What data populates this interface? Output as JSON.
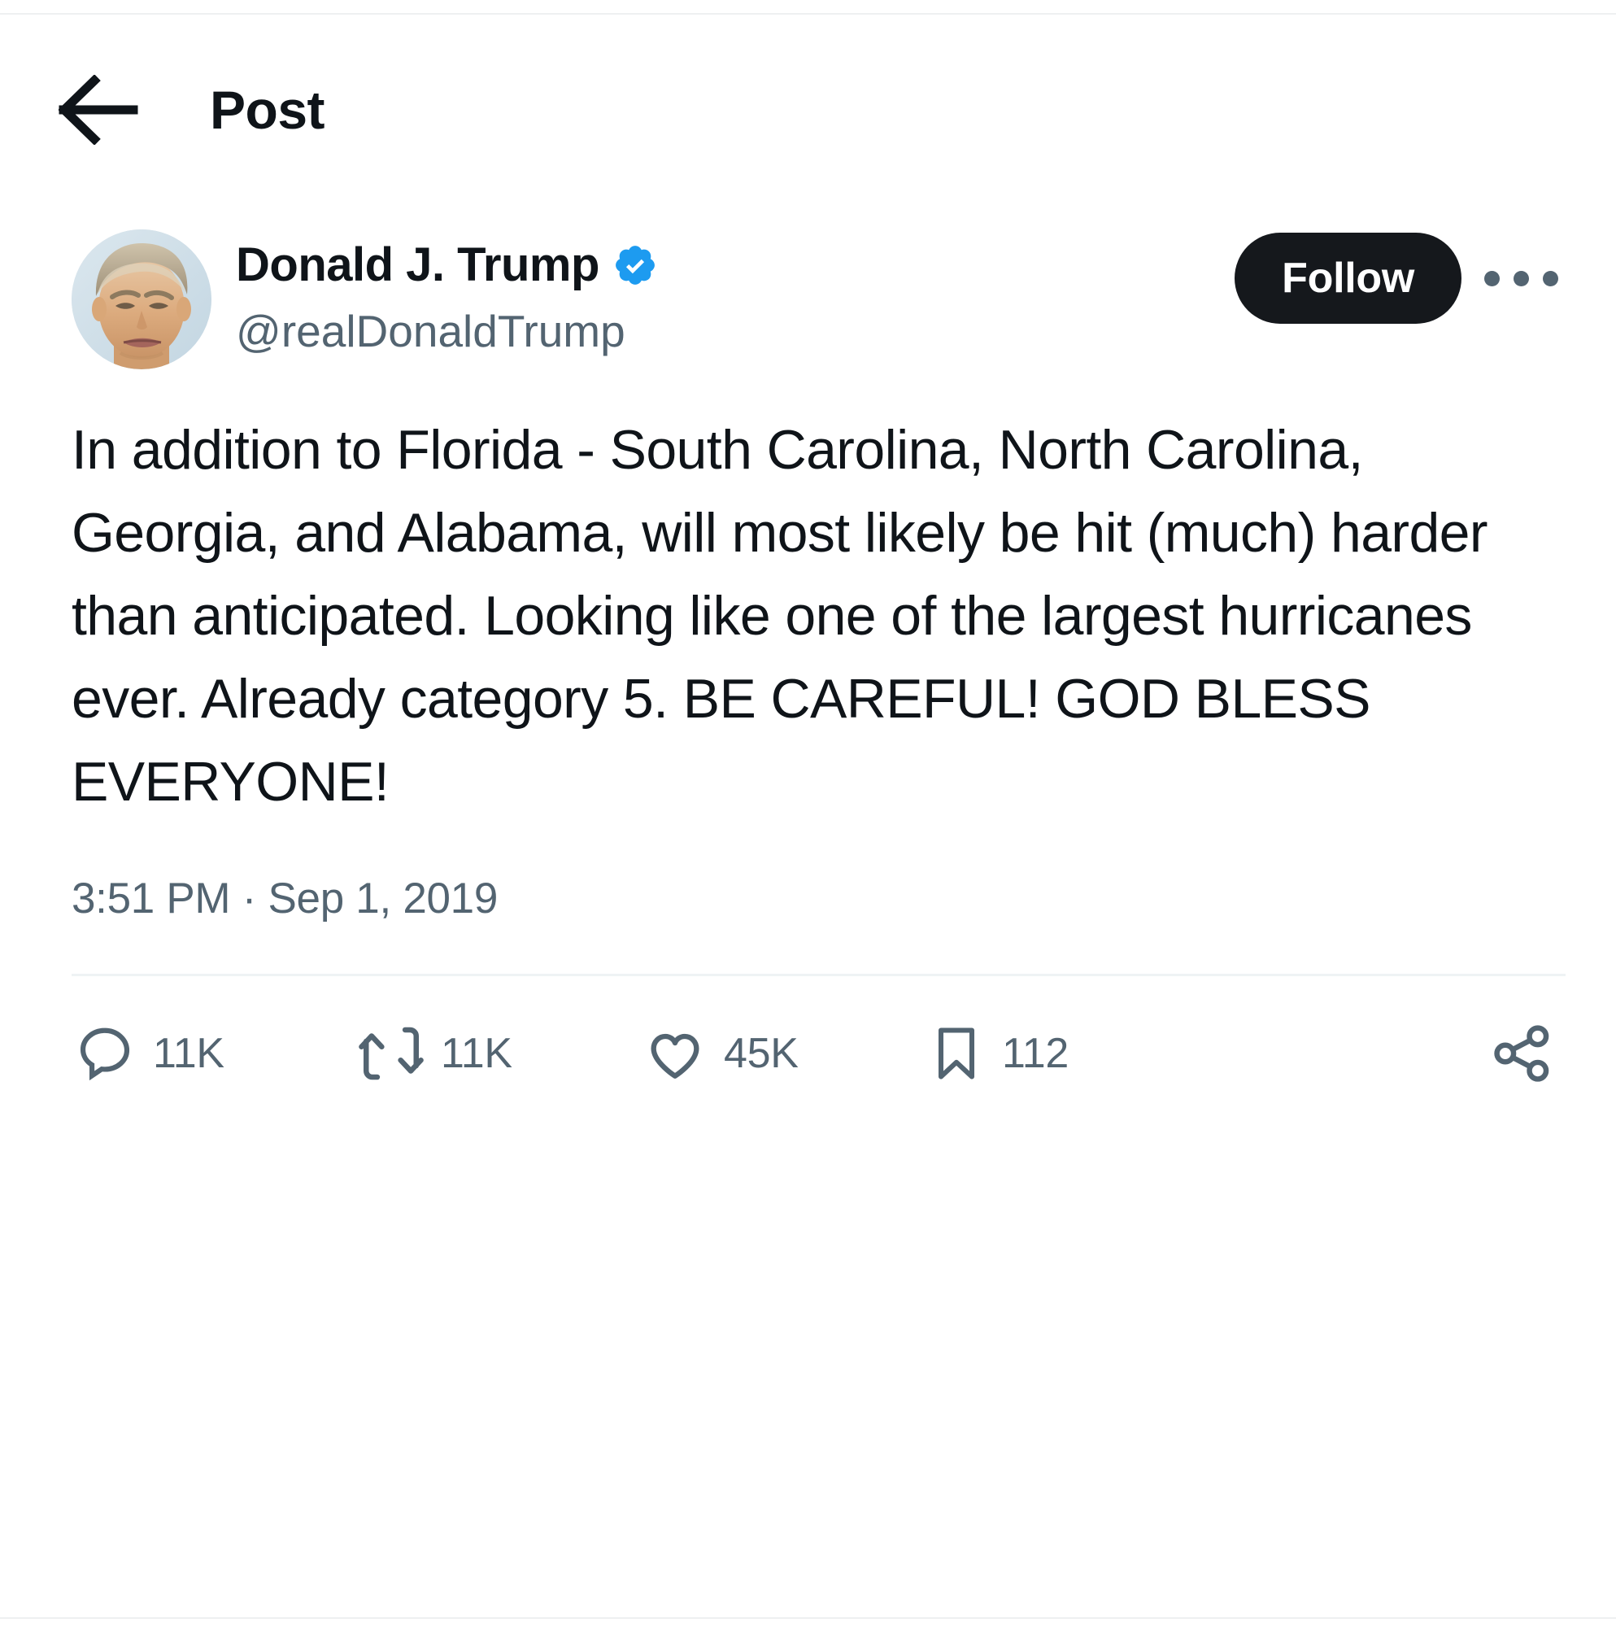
{
  "header": {
    "back_label": "back-arrow",
    "title": "Post"
  },
  "post": {
    "author": {
      "display_name": "Donald J. Trump",
      "handle": "@realDonaldTrump",
      "verified": true,
      "verified_badge_color": "#1d9bf0",
      "avatar_alt": "Donald J. Trump profile photo"
    },
    "follow_button": {
      "label": "Follow",
      "background": "#15181c",
      "text_color": "#ffffff"
    },
    "more_menu_label": "More",
    "text": "In addition to Florida - South Carolina, North Carolina, Georgia, and Alabama, will most likely be hit (much) harder than anticipated. Looking like one of the largest hurricanes ever. Already category 5. BE CAREFUL! GOD BLESS EVERYONE!",
    "timestamp": "3:51 PM · Sep 1, 2019",
    "actions": [
      {
        "name": "reply",
        "icon": "reply-icon",
        "count": "11K"
      },
      {
        "name": "retweet",
        "icon": "retweet-icon",
        "count": "11K"
      },
      {
        "name": "like",
        "icon": "heart-icon",
        "count": "45K"
      },
      {
        "name": "bookmark",
        "icon": "bookmark-icon",
        "count": "112"
      },
      {
        "name": "share",
        "icon": "share-icon",
        "count": ""
      }
    ]
  },
  "colors": {
    "text_primary": "#0f1419",
    "text_secondary": "#536471",
    "accent_blue": "#1d9bf0",
    "divider": "#eff3f4",
    "background": "#ffffff"
  }
}
